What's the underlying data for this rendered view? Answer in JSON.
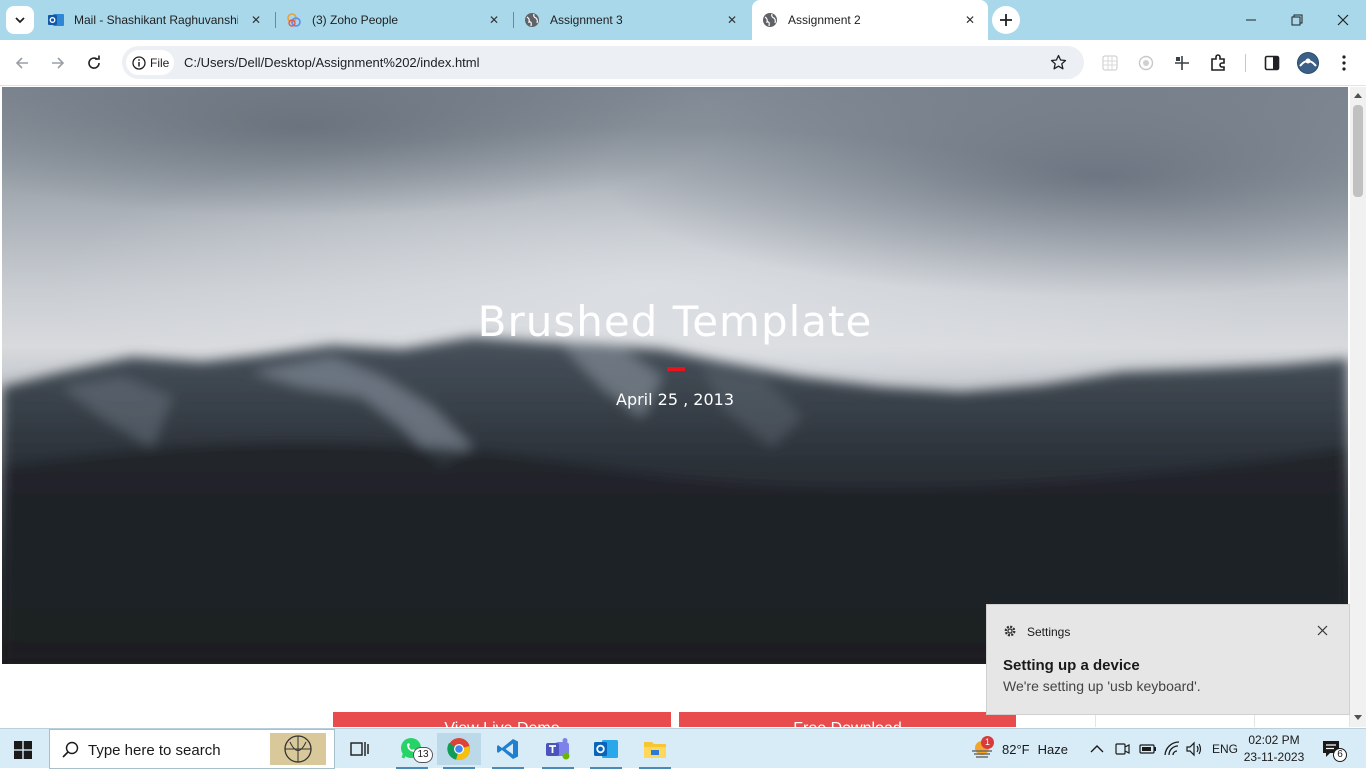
{
  "browser": {
    "tabs": [
      {
        "title": "Mail - Shashikant Raghuvanshi",
        "icon": "outlook-icon",
        "active": false
      },
      {
        "title": "(3) Zoho People",
        "icon": "zoho-icon",
        "active": false
      },
      {
        "title": "Assignment 3",
        "icon": "globe-icon",
        "active": false
      },
      {
        "title": "Assignment 2",
        "icon": "globe-icon",
        "active": true
      }
    ],
    "chip_label": "File",
    "url": "C:/Users/Dell/Desktop/Assignment%202/index.html"
  },
  "page": {
    "hero_title": "Brushed Template",
    "hero_date": "April 25 , 2013",
    "accent_color": "#e8141b",
    "button_color": "#e84c4c",
    "buttons": [
      {
        "label": "View Live Demo"
      },
      {
        "label": "Free Download"
      }
    ]
  },
  "toast": {
    "app": "Settings",
    "title": "Setting up a device",
    "body": "We're setting up 'usb keyboard'."
  },
  "taskbar": {
    "search_placeholder": "Type here to search",
    "whatsapp_badge": "13",
    "weather_temp": "82°F",
    "weather_desc": "Haze",
    "weather_badge": "1",
    "language": "ENG",
    "time": "02:02 PM",
    "date": "23-11-2023",
    "notification_count": "6"
  }
}
